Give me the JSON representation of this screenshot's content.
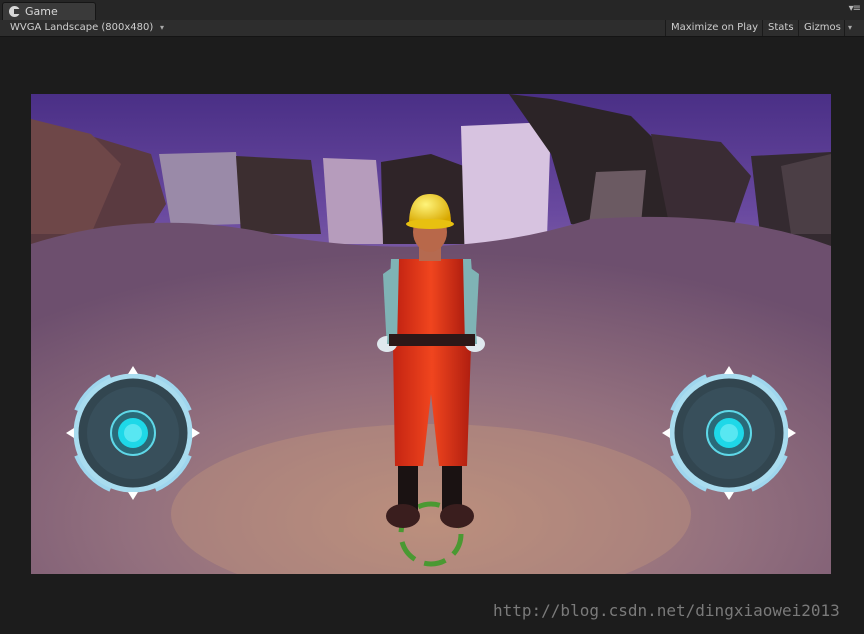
{
  "tab": {
    "title": "Game",
    "icon": "unity-icon"
  },
  "toolbar": {
    "aspect_label": "WVGA Landscape (800x480)",
    "maximize_label": "Maximize on Play",
    "stats_label": "Stats",
    "gizmos_label": "Gizmos"
  },
  "hud": {
    "left_joystick": "move-joystick",
    "right_joystick": "camera-joystick"
  },
  "watermark": "http://blog.csdn.net/dingxiaowei2013"
}
